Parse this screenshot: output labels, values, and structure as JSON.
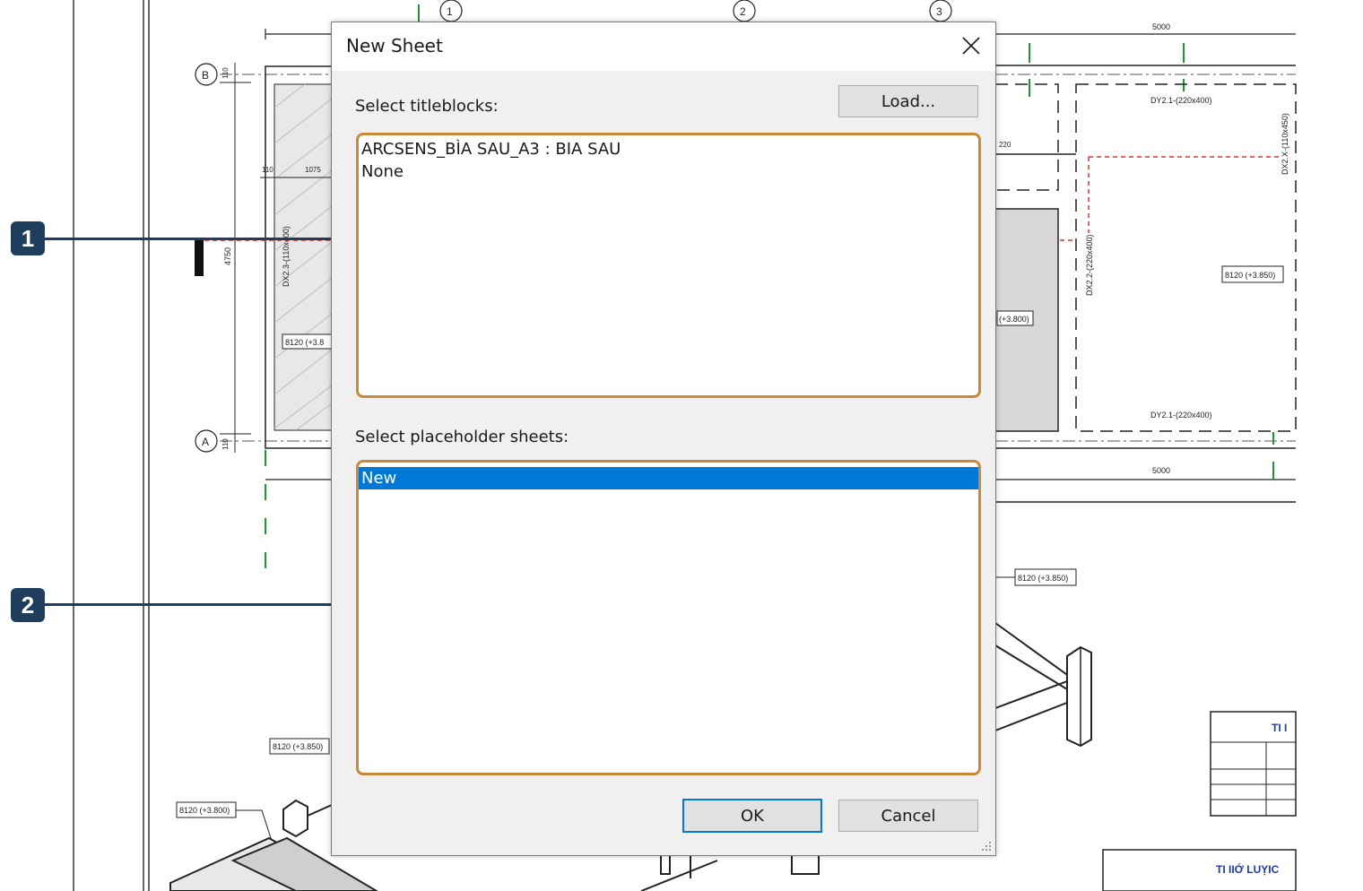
{
  "dialog": {
    "title": "New Sheet",
    "titleblocks_label": "Select titleblocks:",
    "load_button": "Load...",
    "titleblocks": [
      "ARCSENS_BÌA SAU_A3 : BIA SAU",
      "None"
    ],
    "placeholder_label": "Select placeholder sheets:",
    "placeholders": [
      "New"
    ],
    "selected_placeholder": "New",
    "ok_button": "OK",
    "cancel_button": "Cancel"
  },
  "callouts": [
    "1",
    "2"
  ],
  "drawing": {
    "grid_labels": [
      "1",
      "2",
      "3",
      "B",
      "A"
    ],
    "level_tags": [
      "8120 (+3.850)",
      "8120 (+3.850)",
      "8120 (+3.850)",
      "8120 (+3.800)",
      "(+3.800)",
      "8120 (+3.8"
    ],
    "beam_tags": [
      "DY2.1-(220x400)",
      "DY2.1-(220x400)",
      "DX2.X-(110x450)",
      "DX2.2-(220x400)",
      "DX2.3-(110x400)"
    ],
    "dim_texts": [
      "5000",
      "5000",
      "110",
      "110",
      "1075",
      "4750",
      "110",
      "220"
    ],
    "table_texts": [
      "TI I",
      "TI IIỚ LUỴIC"
    ]
  },
  "colors": {
    "accent_select": "#0078d7",
    "callout_fill": "#1f3d5c",
    "highlight_border": "#c8893a",
    "grid_green": "#1a9a2a",
    "dashed_red": "#e03030"
  }
}
